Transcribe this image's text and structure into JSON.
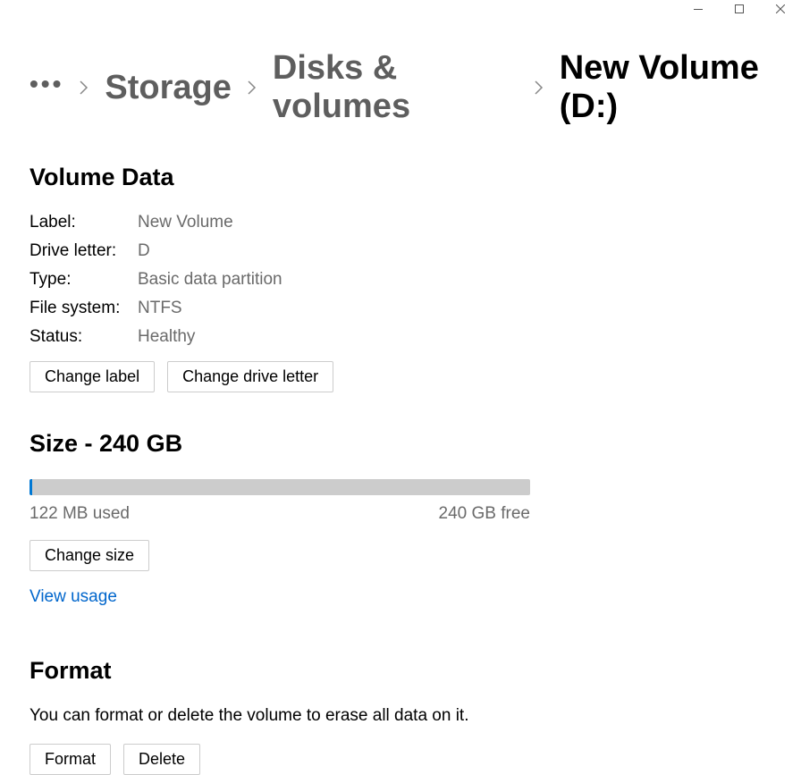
{
  "breadcrumb": {
    "storage": "Storage",
    "disks": "Disks & volumes",
    "current": "New Volume (D:)"
  },
  "volumeData": {
    "title": "Volume Data",
    "labelLabel": "Label:",
    "labelValue": "New Volume",
    "driveLetterLabel": "Drive letter:",
    "driveLetterValue": "D",
    "typeLabel": "Type:",
    "typeValue": "Basic data partition",
    "fileSystemLabel": "File system:",
    "fileSystemValue": "NTFS",
    "statusLabel": "Status:",
    "statusValue": "Healthy",
    "changeLabelBtn": "Change label",
    "changeDriveLetterBtn": "Change drive letter"
  },
  "size": {
    "title": "Size - 240 GB",
    "used": "122 MB used",
    "free": "240 GB free",
    "changeSizeBtn": "Change size",
    "viewUsageLink": "View usage"
  },
  "format": {
    "title": "Format",
    "description": "You can format or delete the volume to erase all data on it.",
    "formatBtn": "Format",
    "deleteBtn": "Delete"
  }
}
